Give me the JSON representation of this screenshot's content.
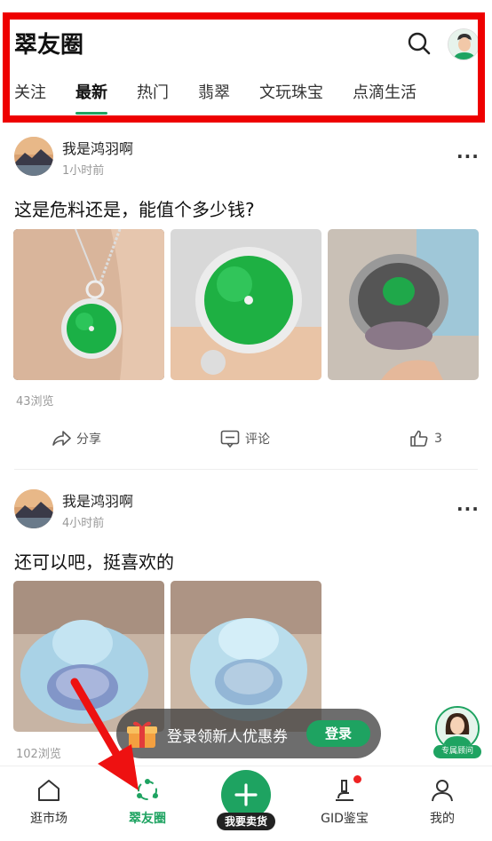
{
  "header": {
    "title": "翠友圈",
    "tabs": [
      "关注",
      "最新",
      "热门",
      "翡翠",
      "文玩珠宝",
      "点滴生活"
    ],
    "active_tab": "最新"
  },
  "posts": [
    {
      "author": "我是鸿羽啊",
      "time": "1小时前",
      "text": "这是危料还是，能值个多少钱?",
      "views": "43浏览",
      "share_label": "分享",
      "comment_label": "评论",
      "like_count": "3"
    },
    {
      "author": "我是鸿羽啊",
      "time": "4小时前",
      "text": "还可以吧，挺喜欢的",
      "views": "102浏览"
    }
  ],
  "promo": {
    "text": "登录领新人优惠券",
    "button_label": "登录"
  },
  "advisor": {
    "tag": "专属顾问"
  },
  "bottom_nav": {
    "items": [
      {
        "label": "逛市场",
        "icon": "house-icon"
      },
      {
        "label": "翠友圈",
        "icon": "community-icon"
      },
      {
        "label": "我要卖货",
        "icon": "plus-icon"
      },
      {
        "label": "GID鉴宝",
        "icon": "microscope-icon"
      },
      {
        "label": "我的",
        "icon": "person-icon"
      }
    ],
    "active": "翠友圈"
  },
  "colors": {
    "accent": "#1ea361",
    "highlight_frame": "#ee0000",
    "arrow": "#ee1111"
  }
}
